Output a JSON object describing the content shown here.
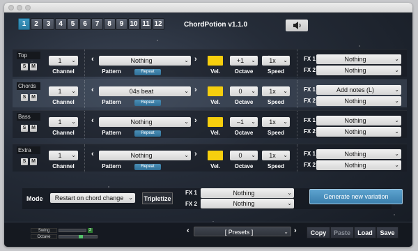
{
  "app": {
    "title": "ChordPotion v1.1.0"
  },
  "colors": {
    "accent": "#3b8ab5",
    "velocity": "#f6cf0e"
  },
  "banks": [
    "1",
    "2",
    "3",
    "4",
    "5",
    "6",
    "7",
    "8",
    "9",
    "10",
    "11",
    "12"
  ],
  "selected_bank": "1",
  "labels": {
    "channel": "Channel",
    "pattern": "Pattern",
    "vel": "Vel.",
    "octave": "Octave",
    "speed": "Speed",
    "repeat": "Repeat",
    "fx1": "FX 1",
    "fx2": "FX 2",
    "solo": "S",
    "mute": "M"
  },
  "tracks": [
    {
      "name": "Top",
      "channel": "1",
      "pattern": "Nothing",
      "octave": "+1",
      "speed": "1x",
      "fx1": "Nothing",
      "fx2": "Nothing"
    },
    {
      "name": "Chords",
      "channel": "1",
      "pattern": "04s beat",
      "octave": "0",
      "speed": "1x",
      "fx1": "Add notes (L)",
      "fx2": "Nothing"
    },
    {
      "name": "Bass",
      "channel": "1",
      "pattern": "Nothing",
      "octave": "–1",
      "speed": "1x",
      "fx1": "Nothing",
      "fx2": "Nothing"
    },
    {
      "name": "Extra",
      "channel": "1",
      "pattern": "Nothing",
      "octave": "0",
      "speed": "1x",
      "fx1": "Nothing",
      "fx2": "Nothing"
    }
  ],
  "mode": {
    "label": "Mode",
    "value": "Restart on chord change",
    "tripletize": "Tripletize",
    "fx1": "Nothing",
    "fx2": "Nothing",
    "generate": "Generate new variation"
  },
  "footer": {
    "swing": "Swing",
    "octave": "Octave",
    "swing_value": "2",
    "presets": "[ Presets ]",
    "copy": "Copy",
    "paste": "Paste",
    "load": "Load",
    "save": "Save"
  },
  "icons": {
    "mute": "speaker-icon",
    "prev": "chevron-left-icon",
    "next": "chevron-right-icon",
    "dropdown": "chevron-down-icon"
  }
}
